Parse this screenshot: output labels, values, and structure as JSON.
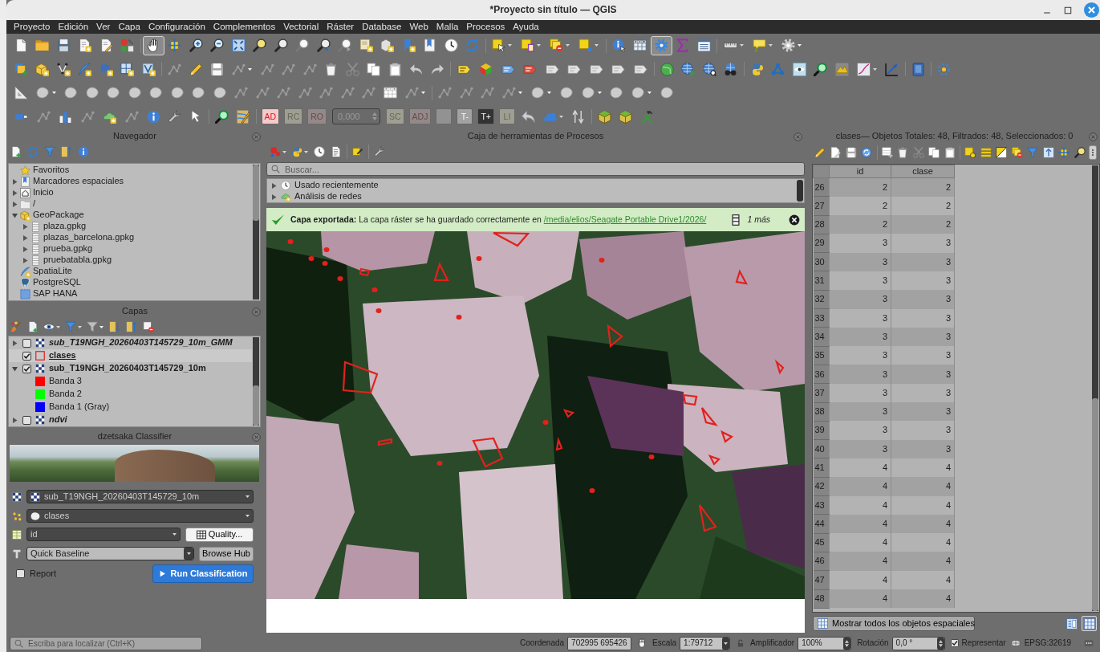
{
  "window": {
    "title": "*Proyecto sin título — QGIS"
  },
  "menu": [
    "Proyecto",
    "Edición",
    "Ver",
    "Capa",
    "Configuración",
    "Complementos",
    "Vectorial",
    "Ráster",
    "Database",
    "Web",
    "Malla",
    "Procesos",
    "Ayuda"
  ],
  "toolbars": [
    {
      "buttons": [
        {
          "disabled": false,
          "pressed": false
        },
        {
          "disabled": false,
          "pressed": false
        },
        {
          "disabled": false,
          "pressed": false
        },
        {
          "disabled": false,
          "pressed": false
        },
        {
          "disabled": false,
          "pressed": false
        },
        {
          "disabled": false,
          "pressed": false
        },
        {
          "disabled": false,
          "pressed": true
        },
        {
          "disabled": false,
          "pressed": false
        },
        {
          "disabled": false,
          "pressed": false
        },
        {
          "disabled": false,
          "pressed": false
        },
        {
          "disabled": false,
          "pressed": false
        },
        {
          "disabled": false,
          "pressed": false
        },
        {
          "disabled": false,
          "pressed": false
        },
        {
          "disabled": true,
          "pressed": false
        },
        {
          "disabled": false,
          "pressed": false
        },
        {
          "disabled": true,
          "pressed": false
        },
        {
          "disabled": false,
          "pressed": false
        },
        {
          "disabled": false,
          "pressed": false
        },
        {
          "disabled": false,
          "pressed": false
        },
        {
          "disabled": false,
          "pressed": false
        },
        {
          "disabled": false,
          "pressed": false
        },
        {
          "disabled": false,
          "pressed": false
        },
        {
          "disabled": false,
          "pressed": false
        },
        {
          "disabled": false,
          "pressed": false
        },
        {
          "disabled": false,
          "pressed": false
        },
        {
          "disabled": false,
          "pressed": false
        },
        {
          "disabled": false,
          "pressed": false
        },
        {
          "disabled": false,
          "pressed": false
        },
        {
          "disabled": false,
          "pressed": true
        },
        {
          "disabled": false,
          "pressed": false
        },
        {
          "disabled": false,
          "pressed": false
        },
        {
          "disabled": false,
          "pressed": false
        },
        {
          "disabled": false,
          "pressed": false
        },
        {
          "disabled": true,
          "pressed": false
        }
      ]
    },
    {
      "buttons": [
        {
          "disabled": false,
          "pressed": false
        },
        {
          "disabled": false,
          "pressed": false
        },
        {
          "disabled": false,
          "pressed": false
        },
        {
          "disabled": false,
          "pressed": false
        },
        {
          "disabled": false,
          "pressed": false
        },
        {
          "disabled": false,
          "pressed": false
        },
        {
          "disabled": false,
          "pressed": false
        },
        {
          "disabled": true,
          "pressed": false
        },
        {
          "disabled": false,
          "pressed": false
        },
        {
          "disabled": true,
          "pressed": false
        },
        {
          "disabled": true,
          "pressed": false
        },
        {
          "disabled": true,
          "pressed": false
        },
        {
          "disabled": true,
          "pressed": false
        },
        {
          "disabled": true,
          "pressed": false
        },
        {
          "disabled": true,
          "pressed": false
        },
        {
          "disabled": true,
          "pressed": false
        },
        {
          "disabled": true,
          "pressed": false
        },
        {
          "disabled": true,
          "pressed": false
        },
        {
          "disabled": true,
          "pressed": false
        },
        {
          "disabled": true,
          "pressed": false
        },
        {
          "disabled": false,
          "pressed": false
        },
        {
          "disabled": false,
          "pressed": false
        },
        {
          "disabled": false,
          "pressed": false
        },
        {
          "disabled": false,
          "pressed": false
        },
        {
          "disabled": true,
          "pressed": false
        },
        {
          "disabled": true,
          "pressed": false
        },
        {
          "disabled": true,
          "pressed": false
        },
        {
          "disabled": true,
          "pressed": false
        },
        {
          "disabled": true,
          "pressed": false
        },
        {
          "disabled": false,
          "pressed": false
        },
        {
          "disabled": false,
          "pressed": false
        },
        {
          "disabled": false,
          "pressed": false
        },
        {
          "disabled": false,
          "pressed": false
        },
        {
          "disabled": false,
          "pressed": false
        },
        {
          "disabled": false,
          "pressed": false
        },
        {
          "disabled": false,
          "pressed": false
        },
        {
          "disabled": false,
          "pressed": false
        },
        {
          "disabled": false,
          "pressed": false
        },
        {
          "disabled": false,
          "pressed": false
        },
        {
          "disabled": false,
          "pressed": false
        },
        {
          "disabled": false,
          "pressed": false
        },
        {
          "disabled": false,
          "pressed": false
        }
      ]
    },
    {
      "buttons": [
        {
          "disabled": true,
          "pressed": false
        },
        {
          "disabled": true,
          "pressed": false
        },
        {
          "disabled": true,
          "pressed": false
        },
        {
          "disabled": true,
          "pressed": false
        },
        {
          "disabled": true,
          "pressed": false
        },
        {
          "disabled": true,
          "pressed": false
        },
        {
          "disabled": true,
          "pressed": false
        },
        {
          "disabled": true,
          "pressed": false
        },
        {
          "disabled": true,
          "pressed": false
        },
        {
          "disabled": true,
          "pressed": false
        },
        {
          "disabled": true,
          "pressed": false
        },
        {
          "disabled": true,
          "pressed": false
        },
        {
          "disabled": true,
          "pressed": false
        },
        {
          "disabled": true,
          "pressed": false
        },
        {
          "disabled": true,
          "pressed": false
        },
        {
          "disabled": true,
          "pressed": false
        },
        {
          "disabled": true,
          "pressed": false
        },
        {
          "disabled": true,
          "pressed": false
        },
        {
          "disabled": true,
          "pressed": false
        },
        {
          "disabled": true,
          "pressed": false
        },
        {
          "disabled": true,
          "pressed": false
        },
        {
          "disabled": true,
          "pressed": false
        },
        {
          "disabled": true,
          "pressed": false
        },
        {
          "disabled": true,
          "pressed": false
        },
        {
          "disabled": true,
          "pressed": false
        },
        {
          "disabled": true,
          "pressed": false
        },
        {
          "disabled": true,
          "pressed": false
        },
        {
          "disabled": true,
          "pressed": false
        },
        {
          "disabled": true,
          "pressed": false
        }
      ]
    },
    {
      "buttons": [
        {
          "disabled": false,
          "pressed": false
        },
        {
          "disabled": true,
          "pressed": false
        },
        {
          "disabled": false,
          "pressed": false
        },
        {
          "disabled": true,
          "pressed": false
        },
        {
          "disabled": false,
          "pressed": false
        },
        {
          "disabled": true,
          "pressed": false
        },
        {
          "disabled": false,
          "pressed": false
        },
        {
          "disabled": false,
          "pressed": false
        },
        {
          "disabled": true,
          "pressed": false
        },
        {
          "disabled": false,
          "pressed": false
        },
        {
          "disabled": false,
          "pressed": false
        },
        {
          "label": "AD",
          "disabled": false,
          "pressed": false
        },
        {
          "label": "RC",
          "disabled": true,
          "pressed": false
        },
        {
          "label": "RO",
          "disabled": true,
          "pressed": false
        },
        {
          "label": "SC",
          "disabled": true,
          "pressed": false
        },
        {
          "label": "ADJ",
          "disabled": true,
          "pressed": false
        },
        {
          "disabled": true,
          "pressed": false
        },
        {
          "label": "T-",
          "disabled": false,
          "pressed": false
        },
        {
          "label": "T+",
          "disabled": false,
          "pressed": false
        },
        {
          "label": "LI",
          "disabled": true,
          "pressed": false
        },
        {
          "disabled": true,
          "pressed": false
        },
        {
          "disabled": false,
          "pressed": false
        },
        {
          "disabled": true,
          "pressed": false
        },
        {
          "disabled": false,
          "pressed": false
        },
        {
          "disabled": false,
          "pressed": false
        },
        {
          "disabled": false,
          "pressed": false
        }
      ],
      "spinbox": {
        "value": "0,000",
        "disabled": true
      }
    }
  ],
  "browser": {
    "title": "Navegador",
    "toolbar": [
      {
        "disabled": false
      },
      {
        "disabled": false
      },
      {
        "disabled": false
      },
      {
        "disabled": false
      },
      {
        "disabled": false
      }
    ],
    "items": [
      {
        "kind": "favorites",
        "label": "Favoritos"
      },
      {
        "kind": "bookmarks",
        "label": "Marcadores espaciales",
        "expanded": false
      },
      {
        "kind": "home",
        "label": "Inicio",
        "expanded": false
      },
      {
        "kind": "folder",
        "label": "/",
        "expanded": false
      },
      {
        "kind": "geopackage",
        "label": "GeoPackage",
        "expanded": true,
        "children": [
          {
            "kind": "file",
            "label": "plaza.gpkg",
            "expanded": false
          },
          {
            "kind": "file",
            "label": "plazas_barcelona.gpkg",
            "expanded": false
          },
          {
            "kind": "file",
            "label": "prueba.gpkg",
            "expanded": false
          },
          {
            "kind": "file",
            "label": "pruebatabla.gpkg",
            "expanded": false
          }
        ]
      },
      {
        "kind": "spatialite",
        "label": "SpatiaLite"
      },
      {
        "kind": "postgresql",
        "label": "PostgreSQL"
      },
      {
        "kind": "hana",
        "label": "SAP HANA"
      }
    ]
  },
  "layers": {
    "title": "Capas",
    "toolbar": [
      {
        "disabled": false
      },
      {
        "disabled": false
      },
      {
        "disabled": false
      },
      {
        "disabled": false
      },
      {
        "disabled": true
      },
      {
        "disabled": false
      },
      {
        "disabled": false
      },
      {
        "disabled": false
      }
    ],
    "items": [
      {
        "kind": "raster",
        "label": "sub_T19NGH_20260403T145729_10m_GMM",
        "checked": false,
        "expanded": false,
        "selected": false
      },
      {
        "kind": "vector",
        "label": "clases",
        "checked": true,
        "selected": true
      },
      {
        "kind": "raster",
        "label": "sub_T19NGH_20260403T145729_10m",
        "checked": true,
        "expanded": true,
        "selected": false,
        "children": [
          {
            "kind": "band",
            "label": "Banda 3",
            "color": "#ff0000",
            "selected": false
          },
          {
            "kind": "band",
            "label": "Banda 2",
            "color": "#00ff00",
            "selected": false
          },
          {
            "kind": "band",
            "label": "Banda 1 (Gray)",
            "color": "#0000ff",
            "selected": false
          }
        ]
      },
      {
        "kind": "raster",
        "label": "ndvi",
        "checked": false,
        "expanded": false,
        "selected": false
      }
    ]
  },
  "classifier": {
    "title": "dzetsaka Classifier",
    "raster": "sub_T19NGH_20260403T145729_10m",
    "vector": "clases",
    "field": "id",
    "quality_button": "Quality...",
    "model": "Quick Baseline",
    "browse_button": "Browse Hub",
    "report": {
      "label": "Report",
      "checked": false
    },
    "run_button": "Run Classification"
  },
  "processing": {
    "title": "Caja de herramientas de Procesos",
    "toolbar": [
      {
        "disabled": false
      },
      {
        "disabled": false
      },
      {
        "disabled": false
      },
      {
        "disabled": false
      },
      {
        "disabled": false
      },
      {
        "disabled": false
      }
    ],
    "search_placeholder": "Buscar...",
    "items": [
      {
        "kind": "recent",
        "label": "Usado recientemente",
        "expanded": false
      },
      {
        "kind": "network",
        "label": "Análisis de redes",
        "expanded": false
      }
    ]
  },
  "message": {
    "text": "**Capa exportada:** La capa ráster se ha guardado correctamente en",
    "link": "/media/elios/Seagate Portable Drive1/2026/",
    "more": "1 más"
  },
  "attribute_table": {
    "title": "clases— Objetos Totales: 48, Filtrados: 48, Seleccionados: 0",
    "toolbar": [
      {
        "disabled": false
      },
      {
        "disabled": true
      },
      {
        "disabled": true
      },
      {
        "disabled": false
      },
      {
        "disabled": true
      },
      {
        "disabled": true
      },
      {
        "disabled": true
      },
      {
        "disabled": true
      },
      {
        "disabled": true
      },
      {
        "disabled": false
      },
      {
        "disabled": false
      },
      {
        "disabled": false
      },
      {
        "disabled": false
      },
      {
        "disabled": false
      },
      {
        "disabled": false
      },
      {
        "disabled": false
      },
      {
        "disabled": false
      }
    ],
    "columns": [
      "id",
      "clase"
    ],
    "rows": [
      {
        "number": "26",
        "cells": [
          "2",
          "2"
        ]
      },
      {
        "number": "27",
        "cells": [
          "2",
          "2"
        ]
      },
      {
        "number": "28",
        "cells": [
          "2",
          "2"
        ]
      },
      {
        "number": "29",
        "cells": [
          "3",
          "3"
        ]
      },
      {
        "number": "30",
        "cells": [
          "3",
          "3"
        ]
      },
      {
        "number": "31",
        "cells": [
          "3",
          "3"
        ]
      },
      {
        "number": "32",
        "cells": [
          "3",
          "3"
        ]
      },
      {
        "number": "33",
        "cells": [
          "3",
          "3"
        ]
      },
      {
        "number": "34",
        "cells": [
          "3",
          "3"
        ]
      },
      {
        "number": "35",
        "cells": [
          "3",
          "3"
        ]
      },
      {
        "number": "36",
        "cells": [
          "3",
          "3"
        ]
      },
      {
        "number": "37",
        "cells": [
          "3",
          "3"
        ]
      },
      {
        "number": "38",
        "cells": [
          "3",
          "3"
        ]
      },
      {
        "number": "39",
        "cells": [
          "3",
          "3"
        ]
      },
      {
        "number": "40",
        "cells": [
          "3",
          "3"
        ]
      },
      {
        "number": "41",
        "cells": [
          "4",
          "4"
        ]
      },
      {
        "number": "42",
        "cells": [
          "4",
          "4"
        ]
      },
      {
        "number": "43",
        "cells": [
          "4",
          "4"
        ]
      },
      {
        "number": "44",
        "cells": [
          "4",
          "4"
        ]
      },
      {
        "number": "45",
        "cells": [
          "4",
          "4"
        ]
      },
      {
        "number": "46",
        "cells": [
          "4",
          "4"
        ]
      },
      {
        "number": "47",
        "cells": [
          "4",
          "4"
        ]
      },
      {
        "number": "48",
        "cells": [
          "4",
          "4"
        ]
      }
    ],
    "show_all": "Mostrar todos los objetos espaciales",
    "views": [
      {
        "selected": false
      },
      {
        "selected": true
      }
    ]
  },
  "status_bar": {
    "locator_placeholder": "Escriba para localizar (Ctrl+K)",
    "coordinate_label": "Coordenada",
    "coordinate": "702995 695426",
    "scale_label": "Escala",
    "scale": "1:79712",
    "magnifier_label": "Amplificador",
    "magnifier": "100%",
    "rotation_label": "Rotación",
    "rotation": "0,0 °",
    "render": {
      "label": "Representar",
      "checked": true
    },
    "crs": "EPSG:32619"
  }
}
